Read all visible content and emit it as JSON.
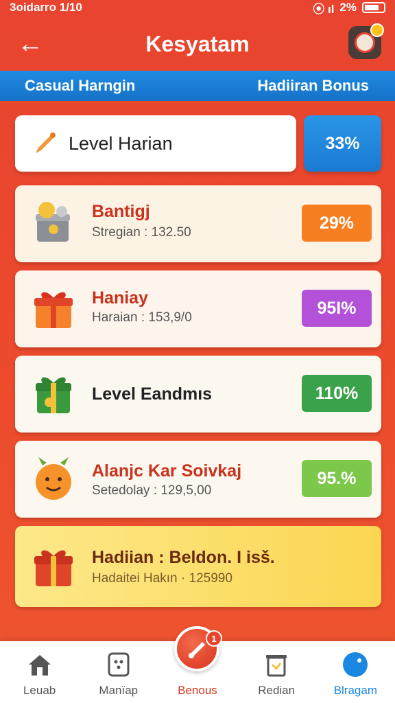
{
  "status_bar": {
    "left": "3oidarro 1/10",
    "signal_text": "2%"
  },
  "header": {
    "title": "Kesyatam"
  },
  "tabs": {
    "left": "Casual Harngin",
    "right": "Hadiiran Bonus"
  },
  "level_card": {
    "label": "Level Harian",
    "percent": "33%"
  },
  "items": [
    {
      "title": "Bantigj",
      "subtitle": "Stregian : 132.50",
      "percent": "29%",
      "percent_color": "#f77f22",
      "icon": "gift-box-icon"
    },
    {
      "title": "Haniay",
      "subtitle": "Haraian : 153,9/0",
      "percent": "95I%",
      "percent_color": "#b352d8",
      "icon": "red-gift-icon"
    },
    {
      "title": "Level Eandmıs",
      "subtitle": "",
      "percent": "110%",
      "percent_color": "#3aa24a",
      "icon": "green-gift-icon"
    },
    {
      "title": "Alanjc Kar Soivkaj",
      "subtitle": "Setedolay : 129,5,00",
      "percent": "95.%",
      "percent_color": "#7cc84a",
      "icon": "orange-face-icon"
    },
    {
      "title": "Hadiian : Beldon. I isš.",
      "subtitle": "Hadaitei Hakın · 125990",
      "percent": "",
      "percent_color": "",
      "icon": "red-gift-icon"
    }
  ],
  "bottom_nav": [
    {
      "label": "Leuab",
      "icon": "home-icon"
    },
    {
      "label": "Manïap",
      "icon": "dice-icon"
    },
    {
      "label": "Benous",
      "icon": "bonus-icon"
    },
    {
      "label": "Redian",
      "icon": "trash-gift-icon"
    },
    {
      "label": "Blragam",
      "icon": "blue-circle-icon"
    }
  ],
  "center_badge": "1"
}
